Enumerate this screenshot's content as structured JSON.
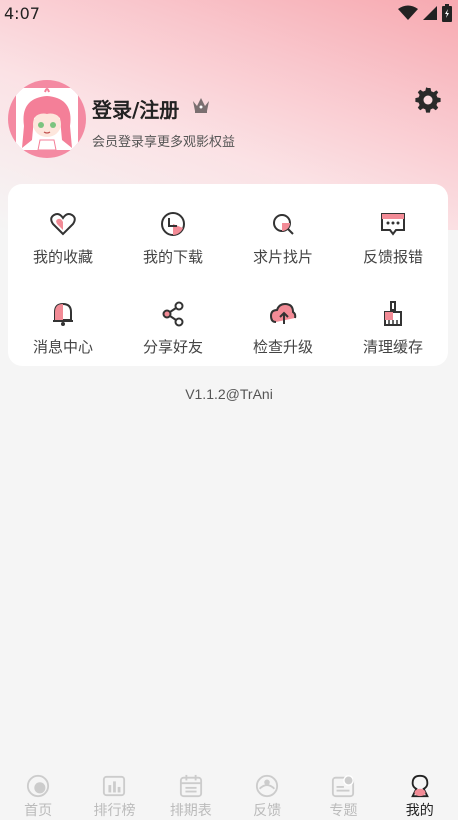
{
  "status": {
    "time": "4:07"
  },
  "profile": {
    "title": "登录/注册",
    "subtitle": "会员登录享更多观影权益"
  },
  "grid": [
    {
      "label": "我的收藏",
      "icon": "heart-icon"
    },
    {
      "label": "我的下载",
      "icon": "download-icon"
    },
    {
      "label": "求片找片",
      "icon": "search-film-icon"
    },
    {
      "label": "反馈报错",
      "icon": "feedback-icon"
    },
    {
      "label": "消息中心",
      "icon": "bell-icon"
    },
    {
      "label": "分享好友",
      "icon": "share-icon"
    },
    {
      "label": "检查升级",
      "icon": "upgrade-icon"
    },
    {
      "label": "清理缓存",
      "icon": "broom-icon"
    }
  ],
  "version": "V1.1.2@TrAni",
  "tabs": [
    {
      "label": "首页",
      "icon": "home-icon"
    },
    {
      "label": "排行榜",
      "icon": "ranking-icon"
    },
    {
      "label": "排期表",
      "icon": "calendar-icon"
    },
    {
      "label": "反馈",
      "icon": "feedback-tab-icon"
    },
    {
      "label": "专题",
      "icon": "topic-icon"
    },
    {
      "label": "我的",
      "icon": "profile-icon"
    }
  ],
  "colors": {
    "accent": "#f28b96",
    "text": "#222222",
    "muted": "#bbbbbb"
  }
}
